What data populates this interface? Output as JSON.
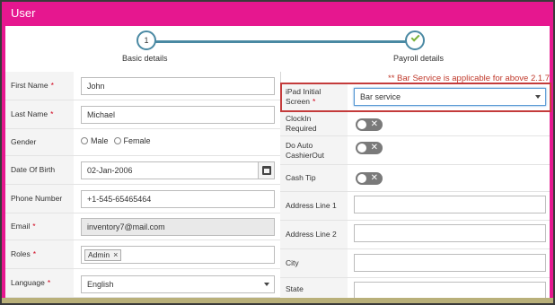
{
  "window": {
    "title": "User"
  },
  "stepper": {
    "steps": [
      {
        "number": "1",
        "label": "Basic details",
        "state": "current"
      },
      {
        "number": "",
        "label": "Payroll details",
        "state": "complete"
      }
    ]
  },
  "note": "** Bar Service is applicable for above 2.1.7",
  "left_form": {
    "first_name": {
      "label": "First Name",
      "required": "*",
      "value": "John"
    },
    "last_name": {
      "label": "Last Name",
      "required": "*",
      "value": "Michael"
    },
    "gender": {
      "label": "Gender",
      "options": [
        "Male",
        "Female"
      ]
    },
    "dob": {
      "label": "Date Of Birth",
      "value": "02-Jan-2006"
    },
    "phone": {
      "label": "Phone Number",
      "value": "+1-545-65465464"
    },
    "email": {
      "label": "Email",
      "required": "*",
      "value": "inventory7@mail.com"
    },
    "roles": {
      "label": "Roles",
      "required": "*",
      "tags": [
        "Admin"
      ],
      "remove_glyph": "×"
    },
    "language": {
      "label": "Language",
      "required": "*",
      "value": "English"
    }
  },
  "right_form": {
    "ipad_screen": {
      "label_line1": "iPad Initial",
      "label_line2": "Screen",
      "required": "*",
      "value": "Bar service"
    },
    "clockin": {
      "label": "ClockIn Required",
      "state": "off",
      "glyph": "✕"
    },
    "auto_cashier": {
      "label_line1": "Do Auto",
      "label_line2": "CashierOut",
      "state": "off",
      "glyph": "✕"
    },
    "cash_tip": {
      "label": "Cash Tip",
      "state": "off",
      "glyph": "✕"
    },
    "address1": {
      "label": "Address Line 1",
      "value": ""
    },
    "address2": {
      "label": "Address Line 2",
      "value": ""
    },
    "city": {
      "label": "City",
      "value": ""
    },
    "state": {
      "label": "State",
      "value": ""
    }
  },
  "colors": {
    "brand": "#e6178f",
    "stepper": "#4a89a3",
    "check": "#7bb33a",
    "required": "#d0021b",
    "highlight": "#c43b3b"
  }
}
